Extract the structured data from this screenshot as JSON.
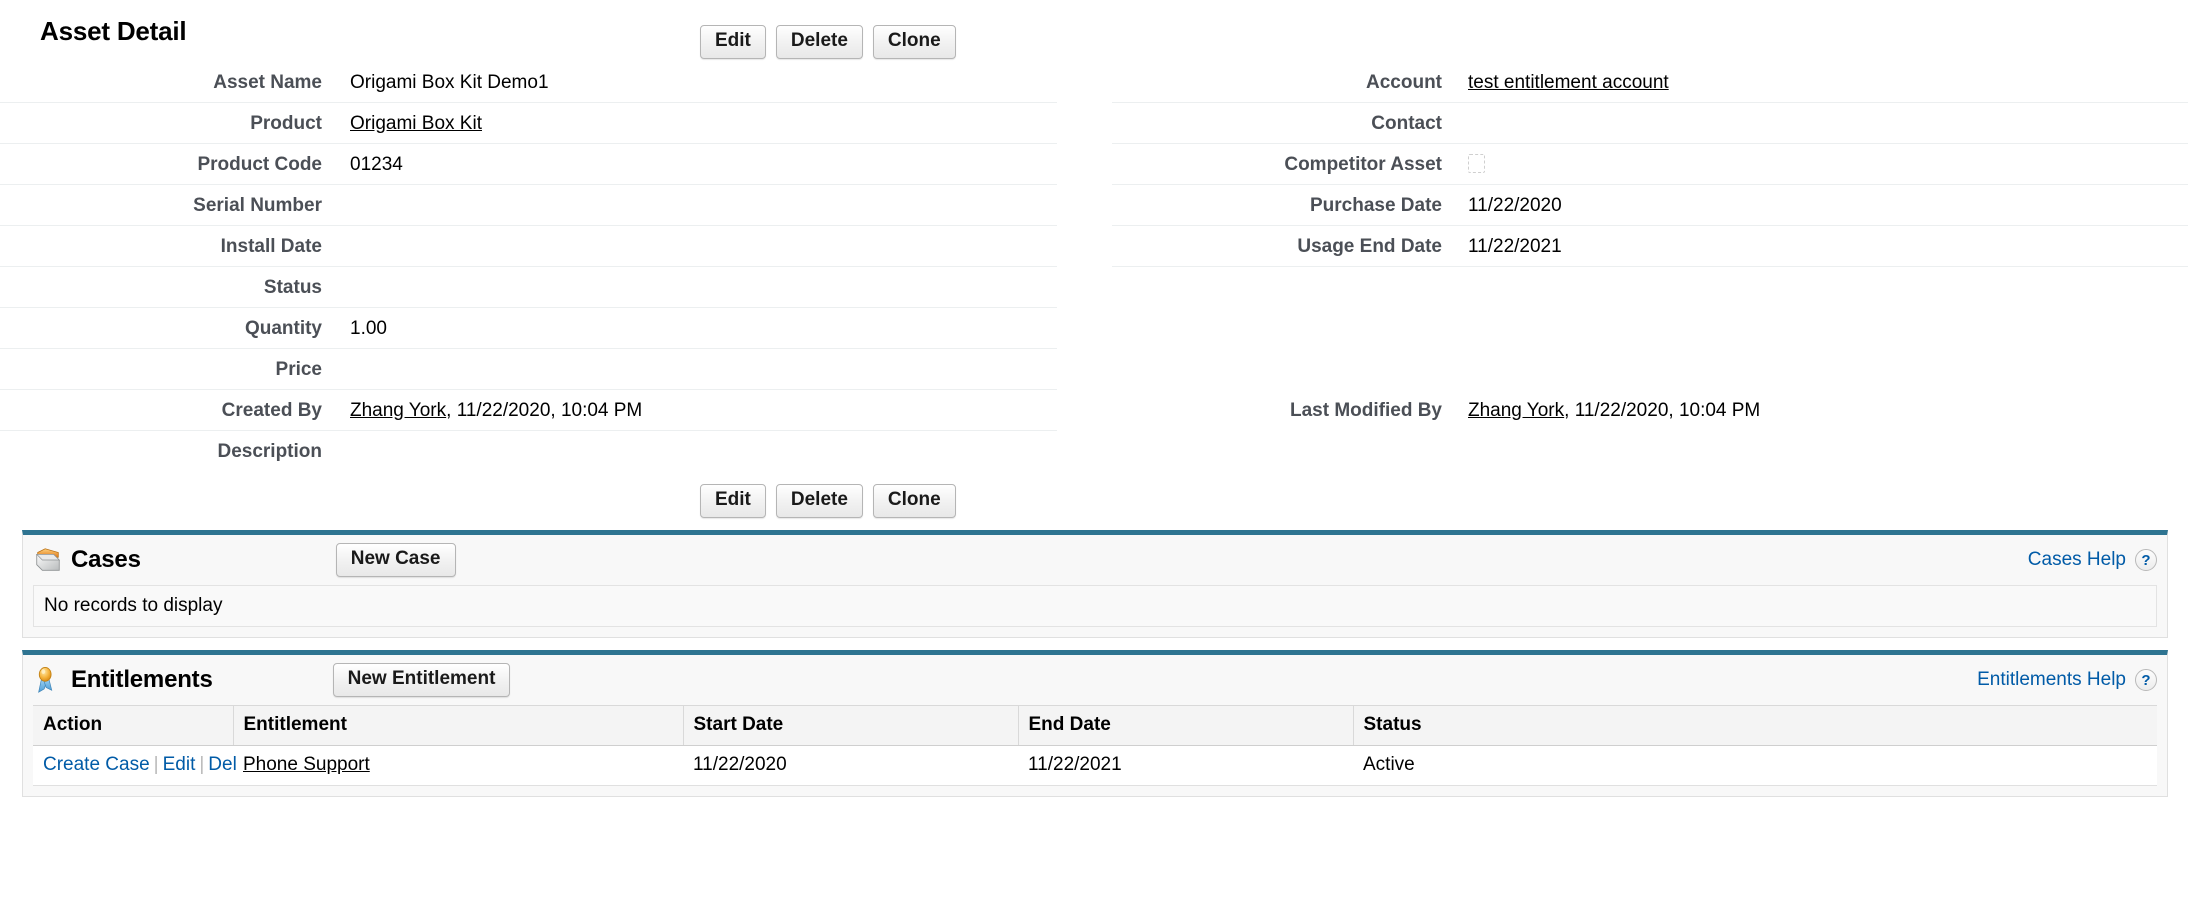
{
  "detail": {
    "title": "Asset Detail",
    "buttons": [
      {
        "label": "Edit",
        "name": "edit-button"
      },
      {
        "label": "Delete",
        "name": "delete-button"
      },
      {
        "label": "Clone",
        "name": "clone-button"
      }
    ],
    "left_fields": [
      {
        "label": "Asset Name",
        "value": "Origami Box Kit Demo1",
        "type": "text"
      },
      {
        "label": "Product",
        "value": "Origami Box Kit",
        "type": "link"
      },
      {
        "label": "Product Code",
        "value": "01234",
        "type": "text"
      },
      {
        "label": "Serial Number",
        "value": "",
        "type": "text"
      },
      {
        "label": "Install Date",
        "value": "",
        "type": "text"
      },
      {
        "label": "Status",
        "value": "",
        "type": "text"
      },
      {
        "label": "Quantity",
        "value": "1.00",
        "type": "text"
      },
      {
        "label": "Price",
        "value": "",
        "type": "text"
      },
      {
        "label": "Created By",
        "value": "Zhang York",
        "type": "user",
        "suffix": ", 11/22/2020, 10:04 PM"
      },
      {
        "label": "Description",
        "value": "",
        "type": "text"
      }
    ],
    "right_fields": [
      {
        "label": "Account",
        "value": "test entitlement account",
        "type": "link"
      },
      {
        "label": "Contact",
        "value": "",
        "type": "text"
      },
      {
        "label": "Competitor Asset",
        "value": "",
        "type": "checkbox",
        "checked": false
      },
      {
        "label": "Purchase Date",
        "value": "11/22/2020",
        "type": "text"
      },
      {
        "label": "Usage End Date",
        "value": "11/22/2021",
        "type": "text"
      },
      {
        "label": "",
        "value": "",
        "type": "blank"
      },
      {
        "label": "",
        "value": "",
        "type": "blank"
      },
      {
        "label": "",
        "value": "",
        "type": "blank"
      },
      {
        "label": "Last Modified By",
        "value": "Zhang York",
        "type": "user",
        "suffix": ", 11/22/2020, 10:04 PM"
      },
      {
        "label": "",
        "value": "",
        "type": "blank"
      }
    ]
  },
  "cases": {
    "title": "Cases",
    "icon": "case-folder-icon",
    "new_button": "New Case",
    "help_label": "Cases Help",
    "help_icon": "question-mark-icon",
    "empty_message": "No records to display"
  },
  "entitlements": {
    "title": "Entitlements",
    "icon": "ribbon-award-icon",
    "new_button": "New Entitlement",
    "help_label": "Entitlements Help",
    "help_icon": "question-mark-icon",
    "columns": [
      "Action",
      "Entitlement",
      "Start Date",
      "End Date",
      "Status"
    ],
    "rows": [
      {
        "actions": [
          "Create Case",
          "Edit",
          "Del"
        ],
        "entitlement": "Phone Support",
        "start_date": "11/22/2020",
        "end_date": "11/22/2021",
        "status": "Active"
      }
    ]
  },
  "colors": {
    "section_accent": "#2e7491",
    "link_blue": "#015ba7",
    "label_gray": "#4b4f56",
    "row_divider": "#eceff0"
  }
}
